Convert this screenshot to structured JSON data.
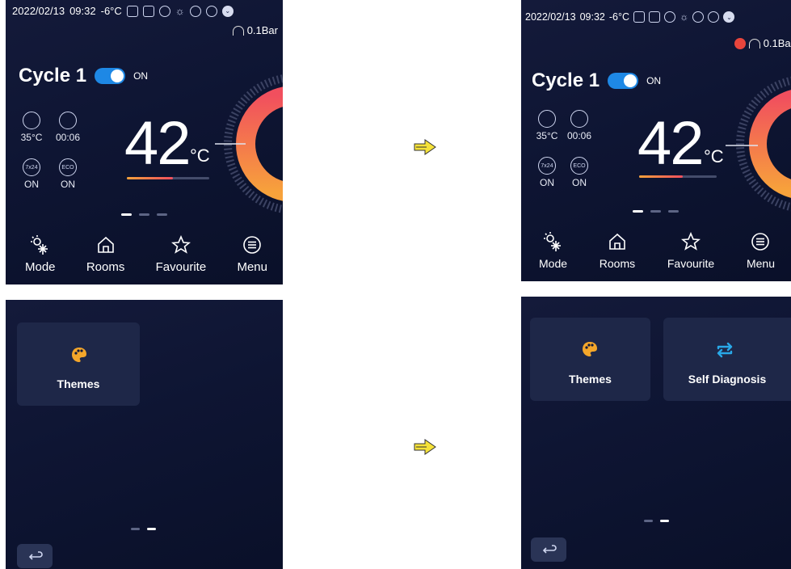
{
  "home": {
    "status": {
      "datetime": "2022/02/13",
      "time": "09:32",
      "outdoor_temp": "-6°C",
      "pressure": "0.1Bar"
    },
    "cycle_title": "Cycle 1",
    "toggle_state": "ON",
    "stats": [
      {
        "icon": "pressure-gauge-icon",
        "value": "35°C"
      },
      {
        "icon": "timer-icon",
        "value": "00:06"
      },
      {
        "icon": "7x24-icon",
        "value": "ON",
        "icon_text": "7x24"
      },
      {
        "icon": "eco-icon",
        "value": "ON",
        "icon_text": "ECO"
      }
    ],
    "temperature": "42",
    "temperature_unit": "°C",
    "nav": [
      {
        "label": "Mode",
        "icon": "snowflake-sun-icon"
      },
      {
        "label": "Rooms",
        "icon": "home-icon"
      },
      {
        "label": "Favourite",
        "icon": "star-icon"
      },
      {
        "label": "Menu",
        "icon": "menu-list-icon"
      }
    ]
  },
  "menu_before": {
    "tiles": [
      {
        "label": "Themes",
        "icon": "palette-icon"
      }
    ]
  },
  "menu_after": {
    "tiles": [
      {
        "label": "Themes",
        "icon": "palette-icon"
      },
      {
        "label": "Self Diagnosis",
        "icon": "swap-arrows-icon"
      }
    ]
  },
  "colors": {
    "accent": "#1e88e5",
    "arc_start": "#f14f5e",
    "arc_end": "#f7a23b",
    "palette": "#f4a62a",
    "diagnosis": "#29a8e8",
    "arrow": "#f5e23a"
  }
}
